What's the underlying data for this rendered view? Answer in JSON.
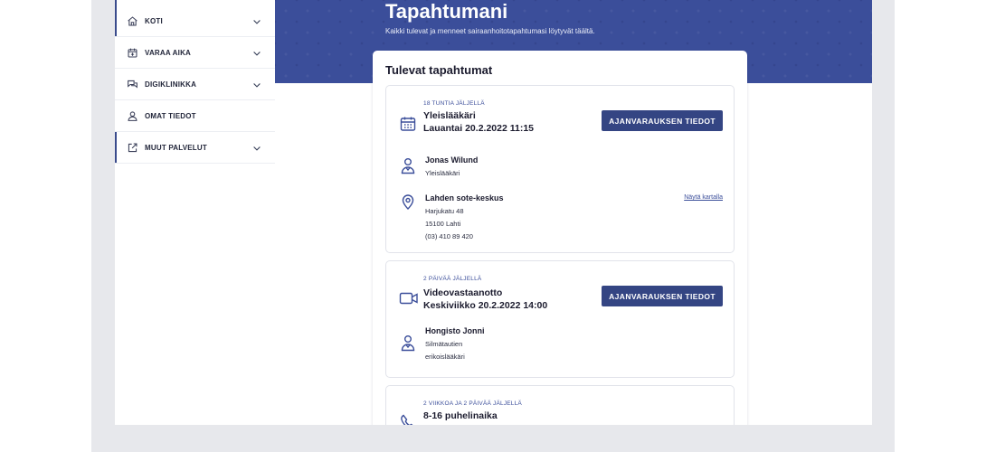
{
  "sidebar": {
    "items": [
      {
        "label": "KOTI",
        "icon": "home-icon",
        "has_chevron": true
      },
      {
        "label": "VARAA AIKA",
        "icon": "calendar-plus-icon",
        "has_chevron": true
      },
      {
        "label": "DIGIKLINIKKA",
        "icon": "chat-bubbles-icon",
        "has_chevron": true
      },
      {
        "label": "OMAT TIEDOT",
        "icon": "user-icon",
        "has_chevron": false
      },
      {
        "label": "MUUT PALVELUT",
        "icon": "external-link-icon",
        "has_chevron": true
      }
    ]
  },
  "header": {
    "title": "Tapahtumani",
    "subtitle": "Kaikki tulevat ja menneet sairaanhoitotapahtumasi löytyvät täältä."
  },
  "upcoming": {
    "title": "Tulevat tapahtumat",
    "events": [
      {
        "remaining": "18 TUNTIA JÄLJELLÄ",
        "type": "Yleislääkäri",
        "datetime": "Lauantai 20.2.2022 11:15",
        "icon": "calendar-icon",
        "button": "AJANVARAUKSEN TIEDOT",
        "person_name": "Jonas Wilund",
        "person_role": "Yleislääkäri",
        "location_name": "Lahden sote-keskus",
        "address": "Harjukatu 48",
        "postal": "15100 Lahti",
        "phone": "(03) 410 89 420",
        "map_link": "Näytä kartalla"
      },
      {
        "remaining": "2 PÄIVÄÄ JÄLJELLÄ",
        "type": "Videovastaanotto",
        "datetime": "Keskiviikko 20.2.2022  14:00",
        "icon": "video-camera-icon",
        "button": "AJANVARAUKSEN TIEDOT",
        "person_name": "Hongisto Jonni",
        "person_role_line1": "Silmätautien",
        "person_role_line2": "erikoislääkäri"
      },
      {
        "remaining": "2 VIIKKOA JA 2 PÄIVÄÄ JÄLJELLÄ",
        "type": "8-16 puhelinaika",
        "icon": "phone-icon"
      }
    ]
  },
  "colors": {
    "brand": "#3b4e9a",
    "button": "#344583",
    "text": "#1b1b2e"
  }
}
